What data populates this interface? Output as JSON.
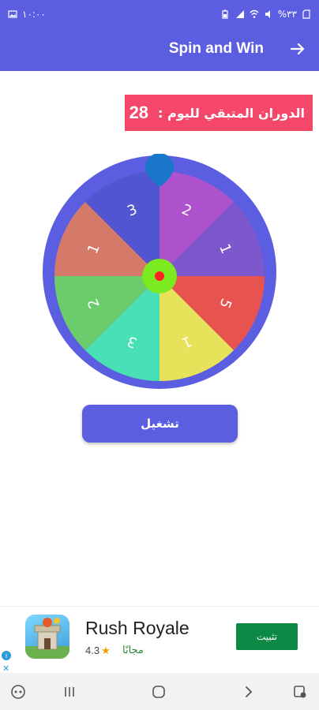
{
  "status_bar": {
    "time": "١٠:٠٠",
    "battery": "%٣٣",
    "icons_left": [
      "gallery-icon"
    ],
    "icons_right": [
      "battery-icon",
      "signal-icon",
      "wifi-icon",
      "mute-icon",
      "sim-icon"
    ]
  },
  "app_bar": {
    "title": "Spin and Win",
    "back_icon": "arrow-right-icon"
  },
  "spins_badge": {
    "label": "الدوران المتبقي لليوم :",
    "count": "28"
  },
  "wheel": {
    "segments": [
      {
        "label": "2",
        "color": "#ad52cc"
      },
      {
        "label": "1",
        "color": "#7d58cd"
      },
      {
        "label": "5",
        "color": "#e8534f"
      },
      {
        "label": "1",
        "color": "#e6e35a"
      },
      {
        "label": "3",
        "color": "#4ae0b5"
      },
      {
        "label": "2",
        "color": "#6ccb6a"
      },
      {
        "label": "1",
        "color": "#d57a68"
      },
      {
        "label": "3",
        "color": "#5155d0"
      }
    ],
    "rim_color": "#5b5ee0",
    "hub_color": "#7bea1e",
    "hub_dot_color": "#ff2222",
    "pointer_color": "#1976c9"
  },
  "play_button": {
    "label": "تشغيل"
  },
  "ad": {
    "title": "Rush Royale",
    "rating": "4.3",
    "free_label": "مجانًا",
    "install_label": "تثبيت"
  },
  "nav_bar": {
    "items": [
      "game-icon",
      "recents-icon",
      "home-icon",
      "back-icon",
      "accessibility-icon"
    ]
  },
  "colors": {
    "primary": "#5b5ee0",
    "badge": "#f4476a",
    "install": "#0c8a45"
  }
}
